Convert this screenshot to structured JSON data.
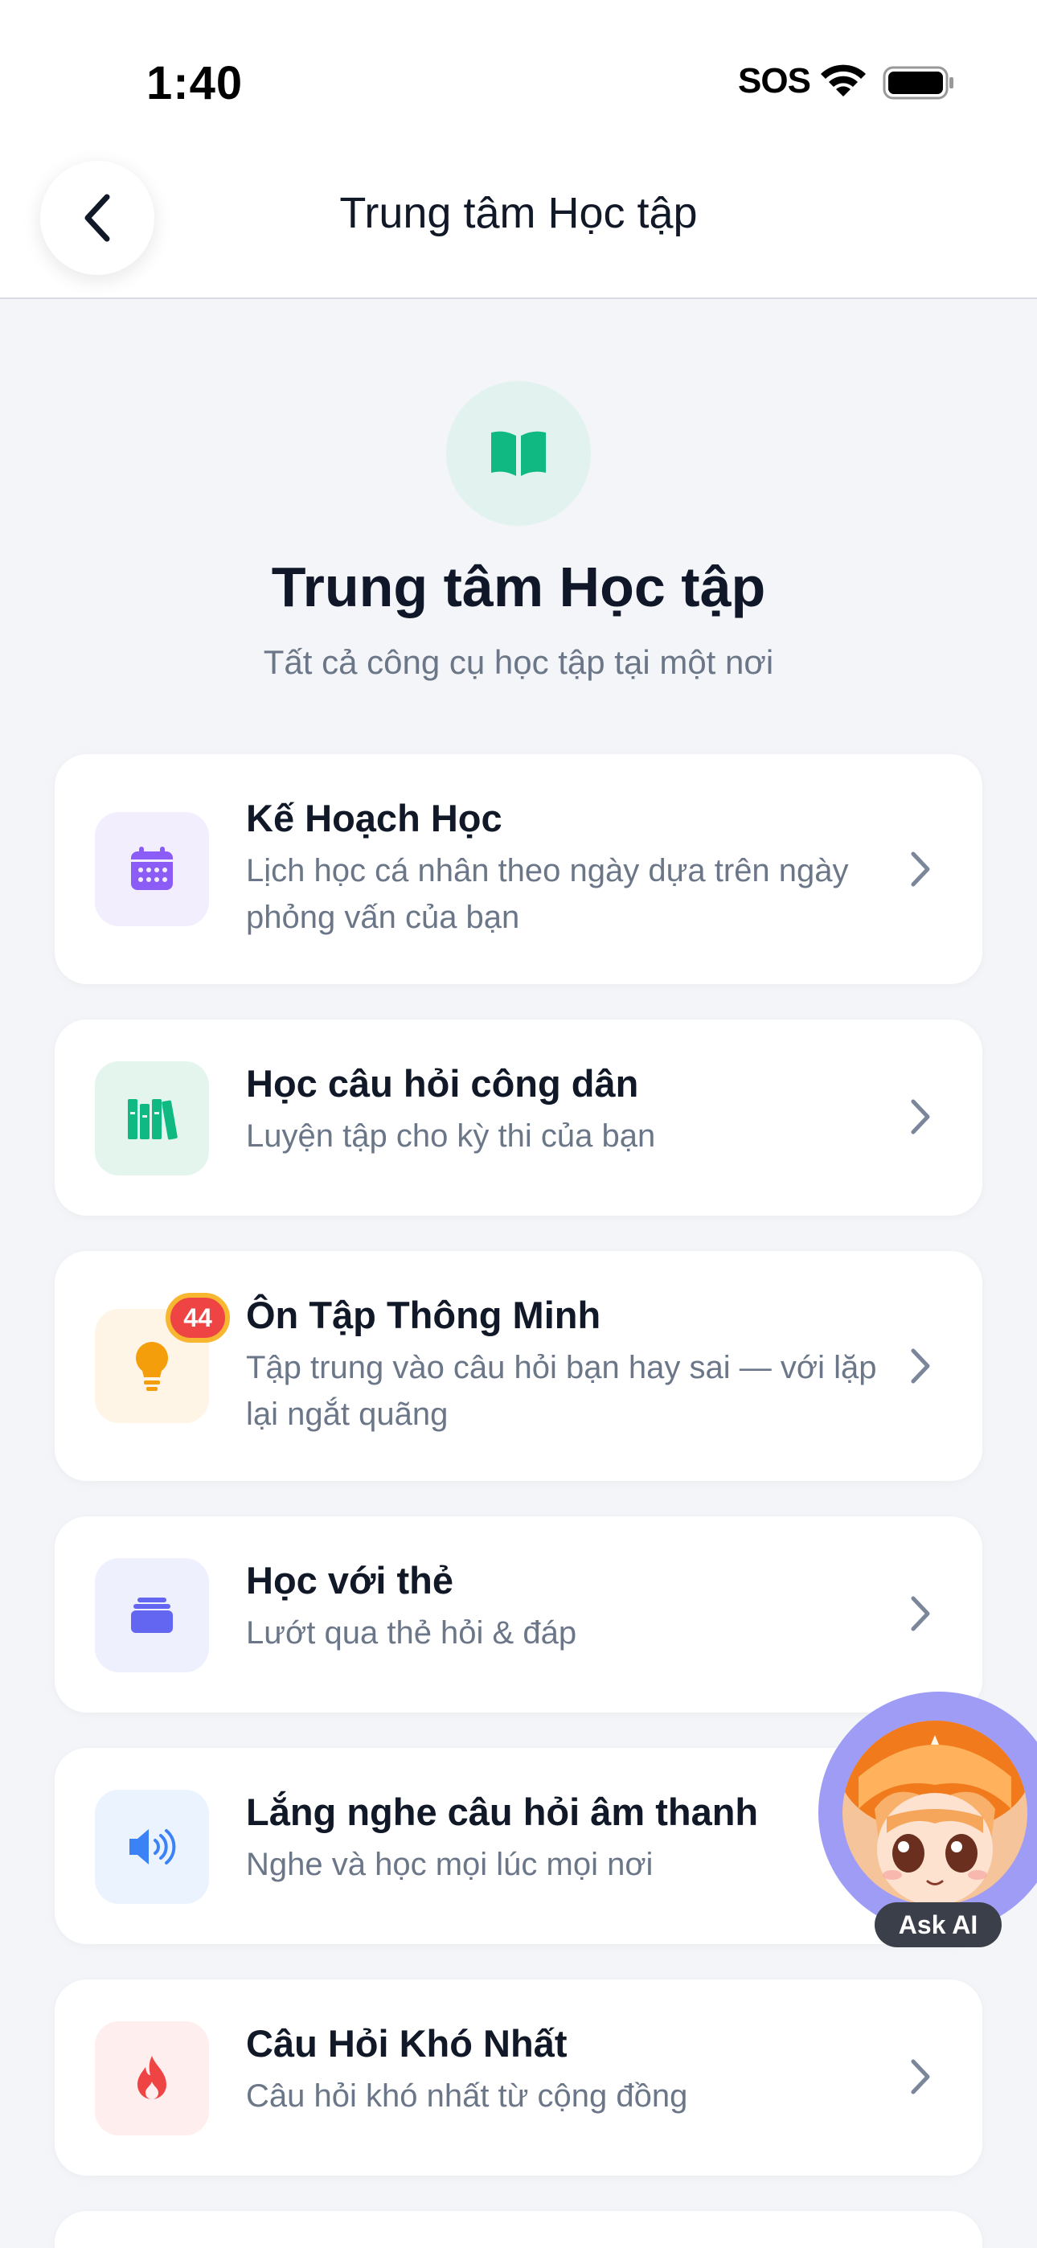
{
  "status_bar": {
    "time": "1:40",
    "sos": "SOS"
  },
  "nav": {
    "title": "Trung tâm Học tập"
  },
  "hero": {
    "icon": "open-book-icon",
    "title": "Trung tâm Học tập",
    "subtitle": "Tất cả công cụ học tập tại một nơi"
  },
  "items": [
    {
      "title": "Kế Hoạch Học",
      "description": "Lịch học cá nhân theo ngày dựa trên ngày phỏng vấn của bạn",
      "icon": "calendar-icon",
      "color": "#8b5cf6",
      "bg": "#f2eefe"
    },
    {
      "title": "Học câu hỏi công dân",
      "description": "Luyện tập cho kỳ thi của bạn",
      "icon": "books-icon",
      "color": "#10b981",
      "bg": "#e4f5ee"
    },
    {
      "title": "Ôn Tập Thông Minh",
      "description": "Tập trung vào câu hỏi bạn hay sai — với lặp lại ngắt quãng",
      "icon": "lightbulb-icon",
      "color": "#f59e0b",
      "bg": "#fff5e6",
      "badge": "44"
    },
    {
      "title": "Học với thẻ",
      "description": "Lướt qua thẻ hỏi & đáp",
      "icon": "cards-icon",
      "color": "#6366f1",
      "bg": "#eef0fe"
    },
    {
      "title": "Lắng nghe câu hỏi âm thanh",
      "description": "Nghe và học mọi lúc mọi nơi",
      "icon": "speaker-icon",
      "color": "#3b82f6",
      "bg": "#ebf3fe"
    },
    {
      "title": "Câu Hỏi Khó Nhất",
      "description": "Câu hỏi khó nhất từ cộng đồng",
      "icon": "flame-icon",
      "color": "#ef4444",
      "bg": "#feeeee"
    }
  ],
  "ask_ai": {
    "label": "Ask AI"
  }
}
